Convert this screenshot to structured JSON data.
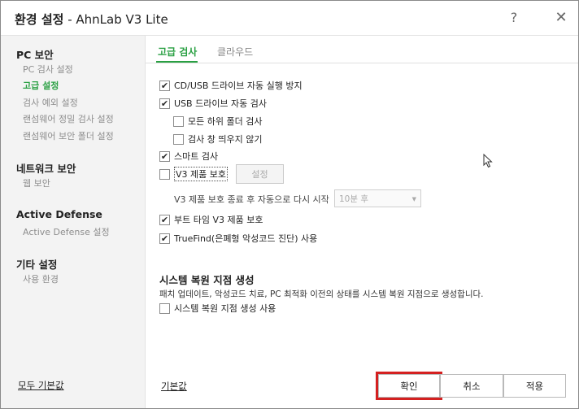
{
  "window": {
    "title_bold": "환경 설정",
    "title_rest": " - AhnLab V3 Lite",
    "help_icon": "?",
    "close_icon": "✕"
  },
  "sidebar": {
    "sections": [
      {
        "heading": "PC 보안",
        "items": [
          "PC 검사 설정",
          "고급 설정",
          "검사 예외 설정",
          "랜섬웨어 정밀 검사 설정",
          "랜섬웨어 보안 폴더 설정"
        ]
      },
      {
        "heading": "네트워크 보안",
        "items": [
          "웹 보안"
        ]
      },
      {
        "heading": "Active Defense",
        "items": [
          "Active Defense 설정"
        ]
      },
      {
        "heading": "기타 설정",
        "items": [
          "사용 환경"
        ]
      }
    ],
    "active_item": "고급 설정",
    "reset_all": "모두 기본값"
  },
  "tabs": [
    {
      "label": "고급 검사",
      "active": true
    },
    {
      "label": "클라우드",
      "active": false
    }
  ],
  "options": {
    "cd_usb_autorun": {
      "label": "CD/USB 드라이브 자동 실행 방지",
      "checked": true
    },
    "usb_autoscan": {
      "label": "USB 드라이브 자동 검사",
      "checked": true
    },
    "all_subfolders": {
      "label": "모든 하위 폴더 검사",
      "checked": false
    },
    "no_scan_window": {
      "label": "검사 창 띄우지 않기",
      "checked": false
    },
    "smart_scan": {
      "label": "스마트 검사",
      "checked": true
    },
    "v3_protect": {
      "label": "V3 제품 보호",
      "checked": false
    },
    "boot_time_protect": {
      "label": "부트 타임 V3 제품 보호",
      "checked": true
    },
    "truefind": {
      "label": "TrueFind(은폐형 악성코드 진단) 사용",
      "checked": true
    }
  },
  "setting_button": "설정",
  "restart": {
    "label": "V3 제품 보호 종료 후 자동으로 다시 시작",
    "select_value": "10분 후"
  },
  "restore": {
    "title": "시스템 복원 지점 생성",
    "description": "패치 업데이트, 악성코드 치료, PC 최적화 이전의 상태를 시스템 복원 지점으로 생성합니다.",
    "option": {
      "label": "시스템 복원 지점 생성 사용",
      "checked": false
    }
  },
  "footer": {
    "reset": "기본값",
    "ok": "확인",
    "cancel": "취소",
    "apply": "적용"
  },
  "colors": {
    "accent": "#2aa043",
    "highlight": "#d42020"
  }
}
